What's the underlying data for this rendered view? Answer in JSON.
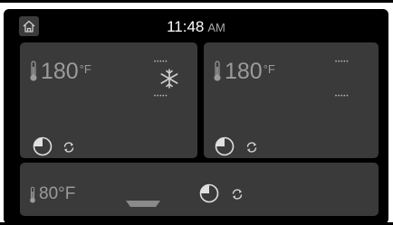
{
  "header": {
    "time": "11:48",
    "ampm": "AM"
  },
  "zones": [
    {
      "temperature": "180",
      "unit": "°F",
      "indicator_top": "•••••",
      "indicator_bottom": "•••••"
    },
    {
      "temperature": "180",
      "unit": "°F",
      "indicator_top": "•••••",
      "indicator_bottom": "•••••"
    },
    {
      "temperature": "80°F"
    }
  ],
  "colors": {
    "screen_bg": "#000000",
    "panel_bg": "#3a3a3a",
    "text_primary": "#ffffff",
    "text_muted": "#9b9b9b"
  }
}
